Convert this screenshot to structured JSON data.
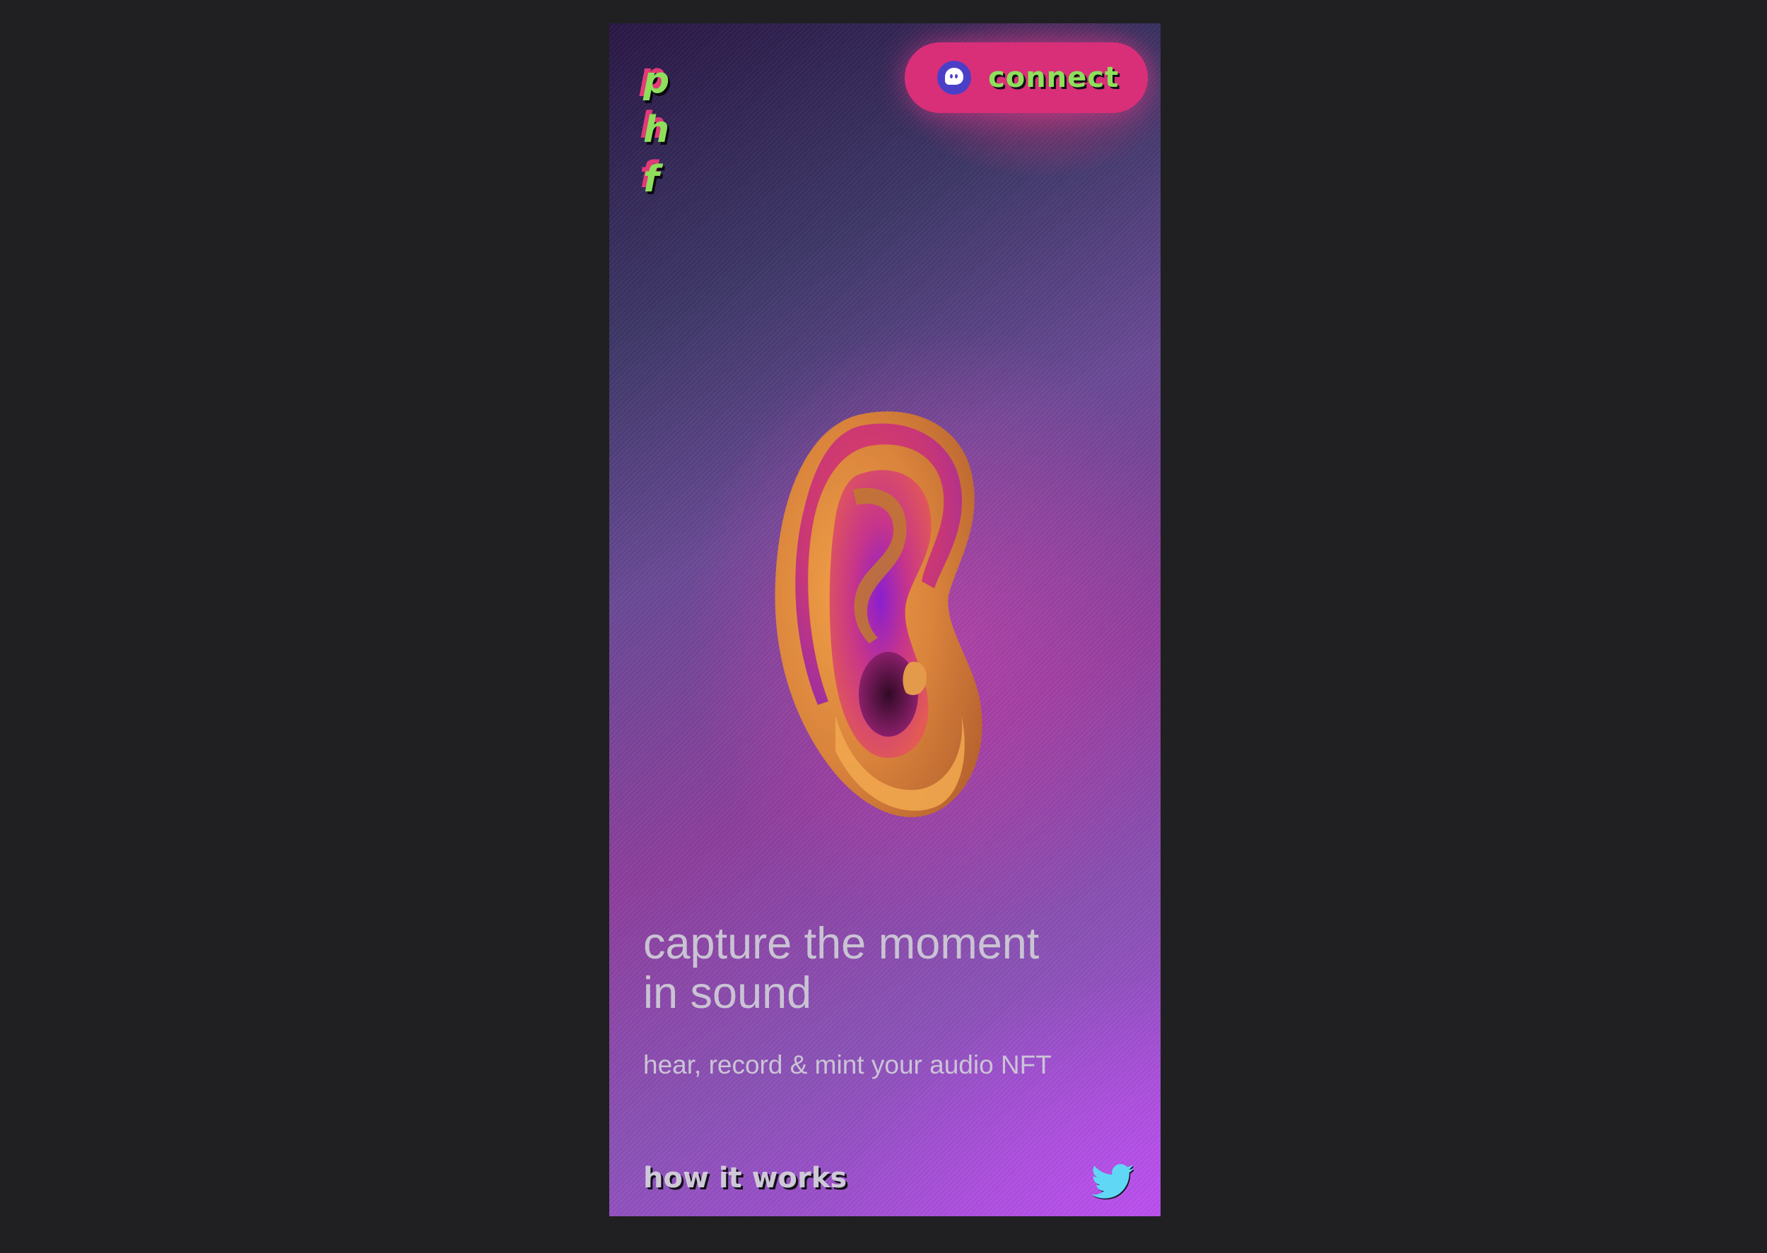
{
  "brand": {
    "letters": [
      "p",
      "h",
      "f"
    ]
  },
  "header": {
    "connect_label": "connect",
    "connect_icon": "ghost-icon"
  },
  "hero": {
    "image": "ear-illustration",
    "headline_line1": "capture the moment",
    "headline_line2": "in sound",
    "subheadline": "hear, record & mint your audio NFT"
  },
  "footer": {
    "how_it_works_label": "how it works",
    "social_icon": "twitter-icon"
  },
  "colors": {
    "accent_pink": "#d92f78",
    "accent_green": "#8ee05a",
    "twitter_cyan": "#5fd7f5",
    "page_bg": "#202022"
  }
}
